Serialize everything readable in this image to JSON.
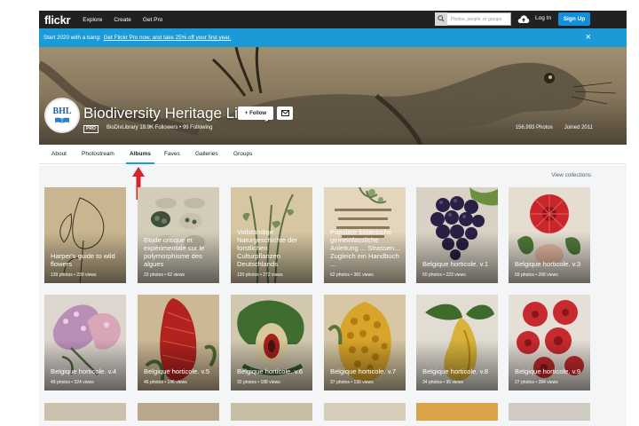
{
  "nav": {
    "logo": "flickr",
    "links": [
      "Explore",
      "Create",
      "Get Pro"
    ],
    "search_placeholder": "Photos, people, or groups",
    "login": "Log In",
    "signup": "Sign Up"
  },
  "banner": {
    "text": "Start 2020 with a bang:",
    "link": "Get Flickr Pro now, and take 25% off your first year.",
    "close": "×"
  },
  "profile": {
    "avatar_text": "BHL",
    "name": "Biodiversity Heritage Library",
    "follow": "+ Follow",
    "pro_badge": "PRO",
    "username": "BioDivLibrary",
    "meta": "BioDivLibrary   18.9K Followers  •  99 Following",
    "photos": "156,993 Photos",
    "joined": "Joined 2011"
  },
  "tabs": [
    "About",
    "Photostream",
    "Albums",
    "Faves",
    "Galleries",
    "Groups"
  ],
  "active_tab": "Albums",
  "view_collections": "View collections",
  "albums": [
    {
      "title": "Harper's guide to wild flowers",
      "meta": "139 photos  •  239 views"
    },
    {
      "title": "Etude critique et expérimentale sur le polymorphisme des algues",
      "meta": "23 photos  •  62 views"
    },
    {
      "title": "Vollständige Naturgeschichte der forstlichen Culturpflanzen Deutschlands",
      "meta": "120 photos  •  272 views"
    },
    {
      "title": "Populäre botanische gemeinfassliche Anleitung ... Strassen... Zugleich ein Handbuch ...",
      "meta": "62 photos  •  381 views"
    },
    {
      "title": "Belgique horticole. v.1",
      "meta": "60 photos  •  223 views"
    },
    {
      "title": "Belgique horticole. v.3",
      "meta": "59 photos  •  268 views"
    },
    {
      "title": "Belgique horticole. v.4",
      "meta": "49 photos  •  324 views"
    },
    {
      "title": "Belgique horticole. v.5",
      "meta": "46 photos  •  146 views"
    },
    {
      "title": "Belgique horticole. v.6",
      "meta": "32 photos  •  188 views"
    },
    {
      "title": "Belgique horticole. v.7",
      "meta": "37 photos  •  130 views"
    },
    {
      "title": "Belgique horticole. v.8",
      "meta": "34 photos  •  95 views"
    },
    {
      "title": "Belgique horticole. v.9",
      "meta": "27 photos  •  284 views"
    }
  ],
  "colors": {
    "nav_bg": "#212124",
    "banner_bg": "#1a9bd8",
    "signup_bg": "#128fdc",
    "tab_underline": "#1a9bd8",
    "annotation_arrow": "#d8232a"
  }
}
